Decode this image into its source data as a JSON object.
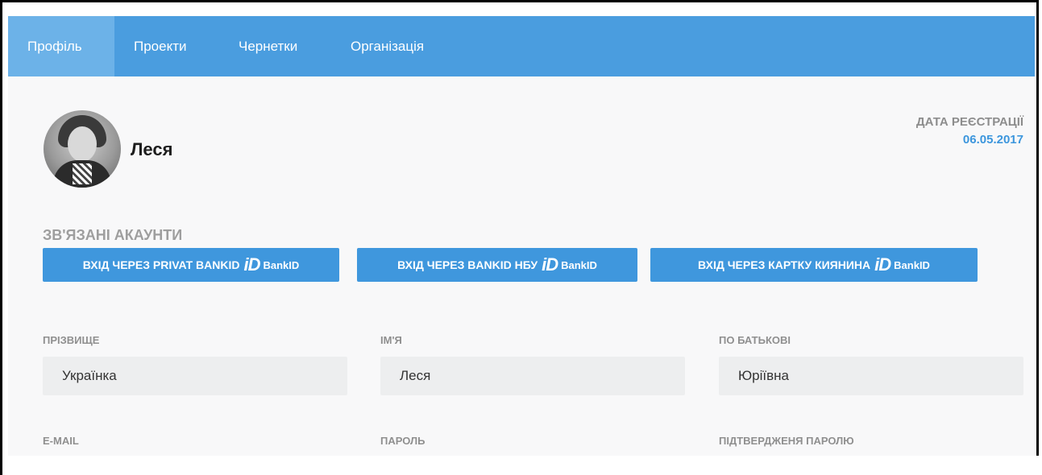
{
  "nav": {
    "tabs": [
      {
        "label": "Профіль",
        "active": true
      },
      {
        "label": "Проекти",
        "active": false
      },
      {
        "label": "Чернетки",
        "active": false
      },
      {
        "label": "Організація",
        "active": false
      }
    ]
  },
  "profile": {
    "name": "Леся",
    "registration_label": "ДАТА РЕЄСТРАЦІЇ",
    "registration_date": "06.05.2017"
  },
  "linked_accounts": {
    "title": "ЗВ'ЯЗАНІ АКАУНТИ",
    "buttons": [
      {
        "label": "ВХІД ЧЕРЕЗ PRIVAT BANKID",
        "icon": "iD",
        "brand": "BankID"
      },
      {
        "label": "ВХІД ЧЕРЕЗ BANKID НБУ",
        "icon": "iD",
        "brand": "BankID"
      },
      {
        "label": "ВХІД ЧЕРЕЗ КАРТКУ КИЯНИНА",
        "icon": "iD",
        "brand": "BankID"
      }
    ]
  },
  "form": {
    "last_name": {
      "label": "ПРІЗВИЩЕ",
      "value": "Українка"
    },
    "first_name": {
      "label": "ІМ'Я",
      "value": "Леся"
    },
    "patronymic": {
      "label": "ПО БАТЬКОВІ",
      "value": "Юріївна"
    },
    "email": {
      "label": "E-MAIL"
    },
    "password": {
      "label": "ПАРОЛЬ"
    },
    "password_confirm": {
      "label": "ПІДТВЕРДЖЕНЯ ПАРОЛЮ"
    }
  },
  "colors": {
    "navbar": "#4a9ddf",
    "nav_active": "#6cb2e8",
    "button": "#3f97dd",
    "date": "#3c96dd",
    "input_bg": "#edeeef"
  }
}
